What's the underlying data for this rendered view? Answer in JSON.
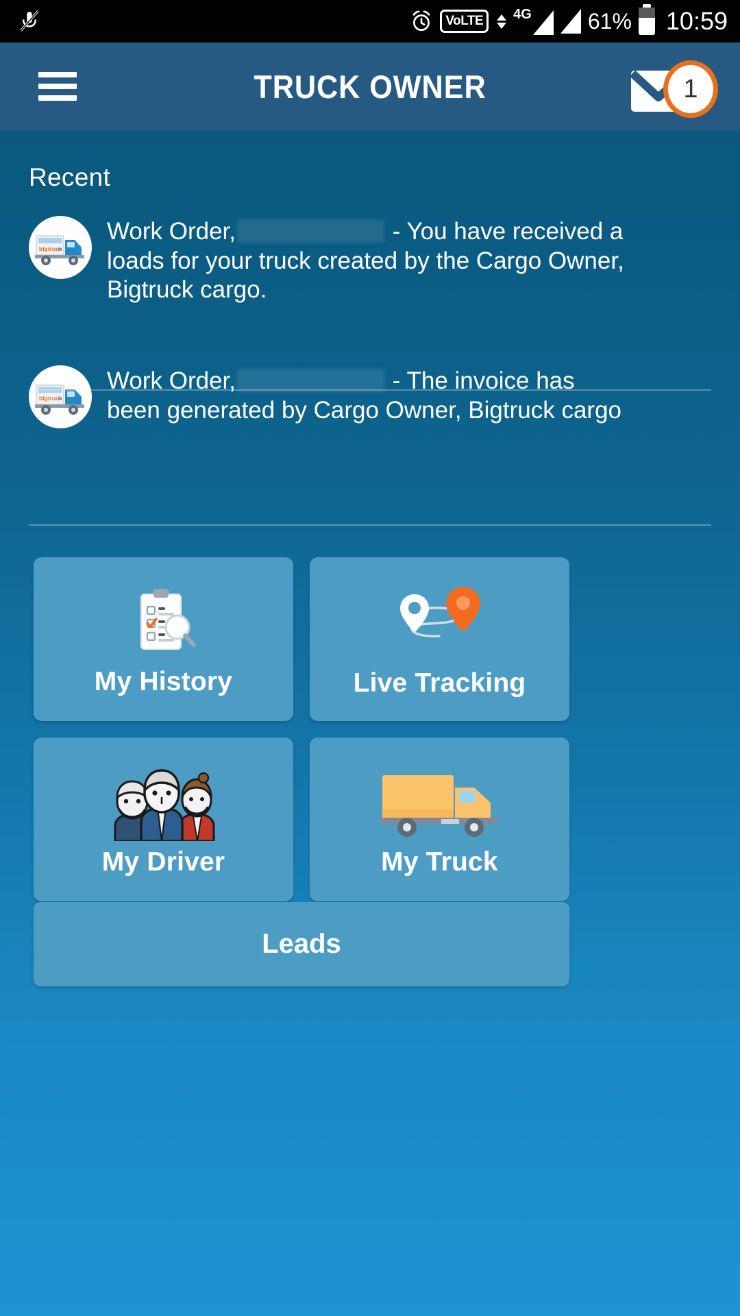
{
  "statusbar": {
    "mic_icon": "mic-off-icon",
    "alarm_icon": "alarm-clock-icon",
    "volte_label": "VoLTE",
    "network_label": "4G",
    "battery_percent": "61%",
    "time": "10:59"
  },
  "header": {
    "menu_icon": "hamburger-menu-icon",
    "title": "TRUCK OWNER",
    "mail_icon": "mail-envelope-icon",
    "badge_count": "1"
  },
  "recent": {
    "section_label": "Recent",
    "notifications": [
      {
        "avatar": "bigtruck-logo-avatar",
        "prefix": "Work Order,",
        "redacted_id": "",
        "message": " - You have received a loads for your truck created by the Cargo Owner, Bigtruck cargo."
      },
      {
        "avatar": "bigtruck-logo-avatar",
        "prefix": "Work Order,",
        "redacted_id": "",
        "message": " - The invoice has been generated by Cargo Owner, Bigtruck cargo"
      }
    ]
  },
  "tiles": [
    {
      "label": "My History",
      "icon": "clipboard-search-icon"
    },
    {
      "label": "Live Tracking",
      "icon": "map-pin-route-icon"
    },
    {
      "label": "My Driver",
      "icon": "drivers-group-icon"
    },
    {
      "label": "My Truck",
      "icon": "truck-icon"
    }
  ],
  "leads": {
    "label": "Leads"
  },
  "colors": {
    "statusbar_bg": "#000000",
    "appbar_bg": "#265a82",
    "page_top_bg": "#0a557a",
    "page_bottom_bg": "#1e93d2",
    "tile_bg": "#4d9cc3",
    "badge_ring": "#e8711a",
    "accent_orange": "#f36b21",
    "text_on_dark": "#ffffff"
  }
}
